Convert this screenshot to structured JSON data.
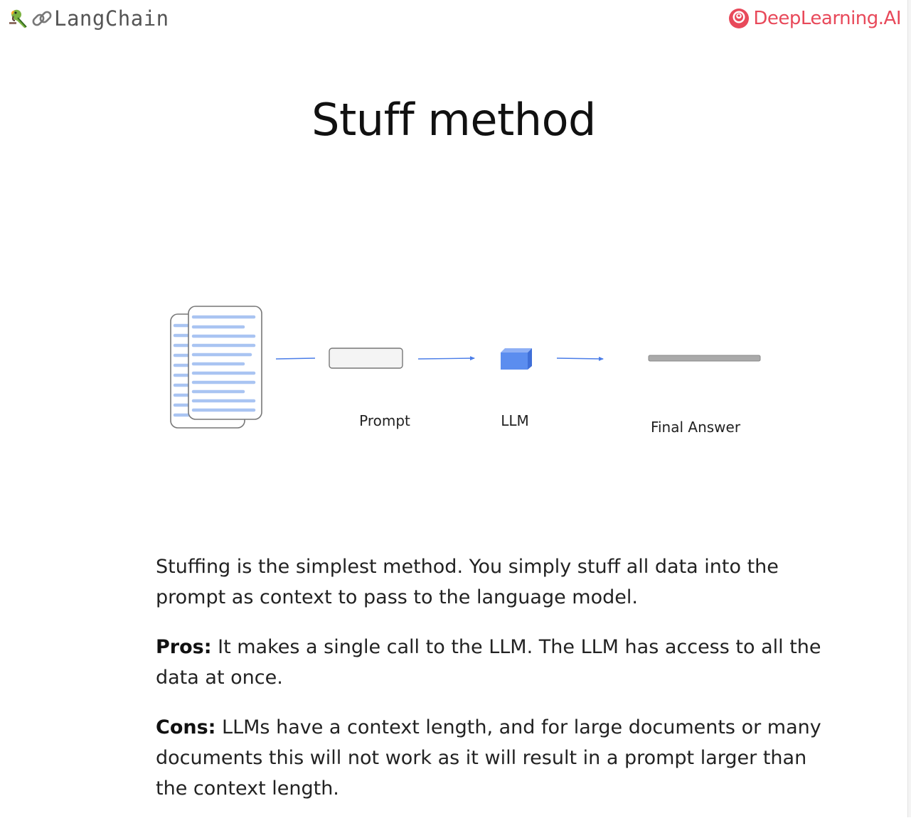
{
  "header": {
    "left_brand": "LangChain",
    "left_icons": [
      "parrot-icon",
      "chain-link-icon"
    ],
    "right_brand": "DeepLearning.AI",
    "right_icon": "deeplearning-ai-logo-icon",
    "right_brand_color": "#e8495a"
  },
  "slide": {
    "title": "Stuff method"
  },
  "diagram": {
    "labels": {
      "prompt": "Prompt",
      "llm": "LLM",
      "final_answer": "Final Answer"
    },
    "colors": {
      "document_lines": "#a9c4f2",
      "arrow": "#4a7de8",
      "llm_cube": "#5b8def",
      "answer_bar": "#aaaaaa"
    }
  },
  "description": {
    "intro": "Stuffing is the simplest method. You simply stuff all data into the prompt as context to pass to the language model.",
    "pros_label": "Pros:",
    "pros_text": " It makes a single call to the LLM. The LLM has access to all the data at once.",
    "cons_label": "Cons:",
    "cons_text": " LLMs have a context length, and for large documents or many documents this will not work as it will result in a prompt larger than the context length."
  }
}
